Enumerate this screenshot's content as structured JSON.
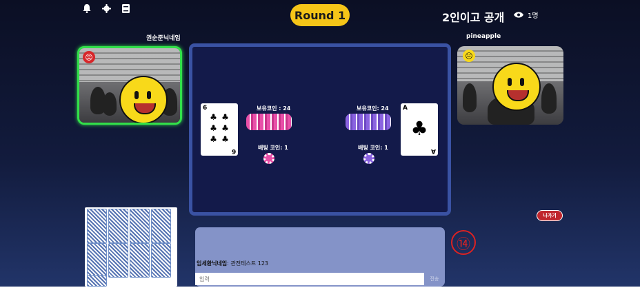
{
  "header": {
    "icons": [
      "bell-icon",
      "gear-icon",
      "book-icon"
    ],
    "round_label": "Round 1",
    "room_title": "2인이고 공개",
    "viewer_count": "1명"
  },
  "players": {
    "left": {
      "name": "권순준닉네임",
      "emoji": "😡",
      "active": true
    },
    "right": {
      "name": "pineapple",
      "emoji": "😐",
      "active": false
    }
  },
  "table": {
    "left_card": {
      "rank": "6",
      "suit": "♣"
    },
    "right_card": {
      "rank": "A",
      "suit": "♣"
    },
    "left_coins_label": "보유코인 : 24",
    "right_coins_label": "보유코인: 24",
    "left_bet_label": "배팅 코인: 1",
    "right_bet_label": "배팅 코인: 1"
  },
  "chat": {
    "sender": "임세환닉네임",
    "message": ": 관전테스트 123",
    "input_placeholder": "입력",
    "send_label": "전송"
  },
  "exit_label": "나가기",
  "marker": "⑭",
  "colors": {
    "round_badge": "#f5c518",
    "active_border": "#32e04a",
    "exit_button": "#c0262d",
    "chip_pink": "#e84fa8",
    "chip_purple": "#8a63e0"
  }
}
